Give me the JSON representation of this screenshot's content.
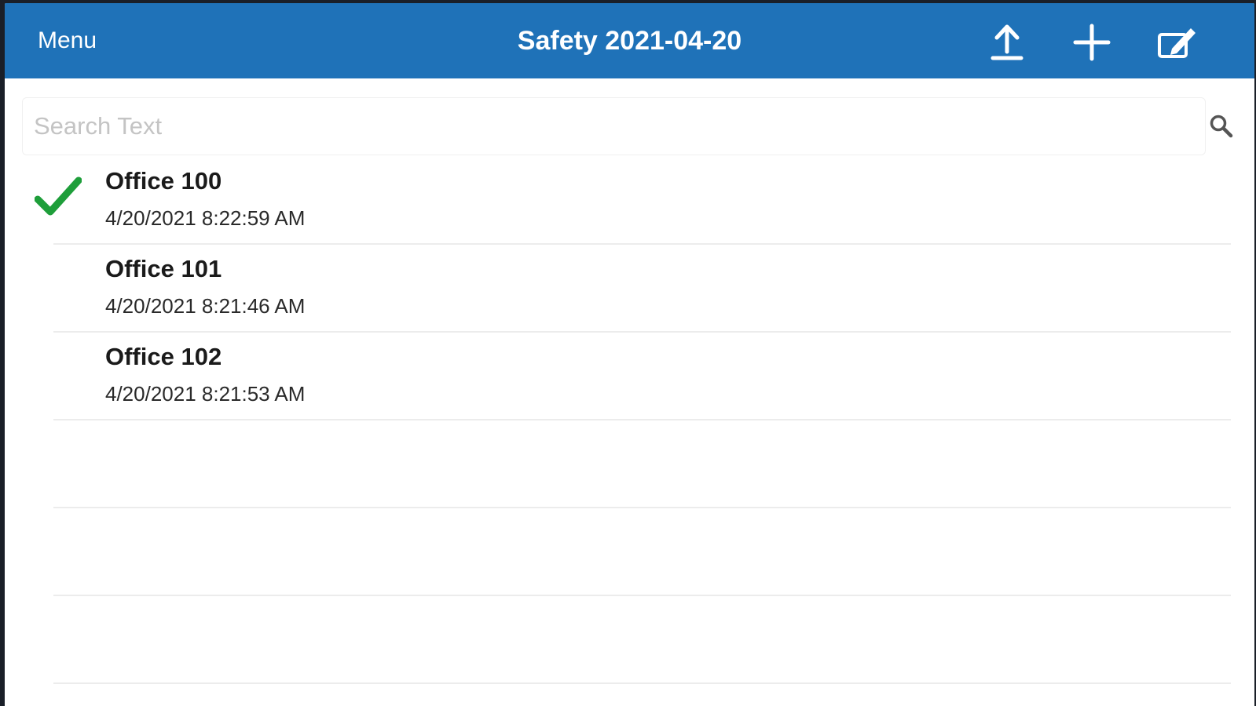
{
  "header": {
    "menu_label": "Menu",
    "title": "Safety 2021-04-20",
    "icons": [
      "upload-icon",
      "plus-icon",
      "edit-icon"
    ],
    "background": "#1f72b8"
  },
  "search": {
    "placeholder": "Search Text",
    "value": ""
  },
  "items": [
    {
      "name": "Office 100",
      "timestamp": "4/20/2021 8:22:59 AM",
      "checked": true
    },
    {
      "name": "Office 101",
      "timestamp": "4/20/2021 8:21:46 AM",
      "checked": false
    },
    {
      "name": "Office 102",
      "timestamp": "4/20/2021 8:21:53 AM",
      "checked": false
    }
  ],
  "colors": {
    "accent": "#1f72b8",
    "check": "#1e9e3a"
  }
}
